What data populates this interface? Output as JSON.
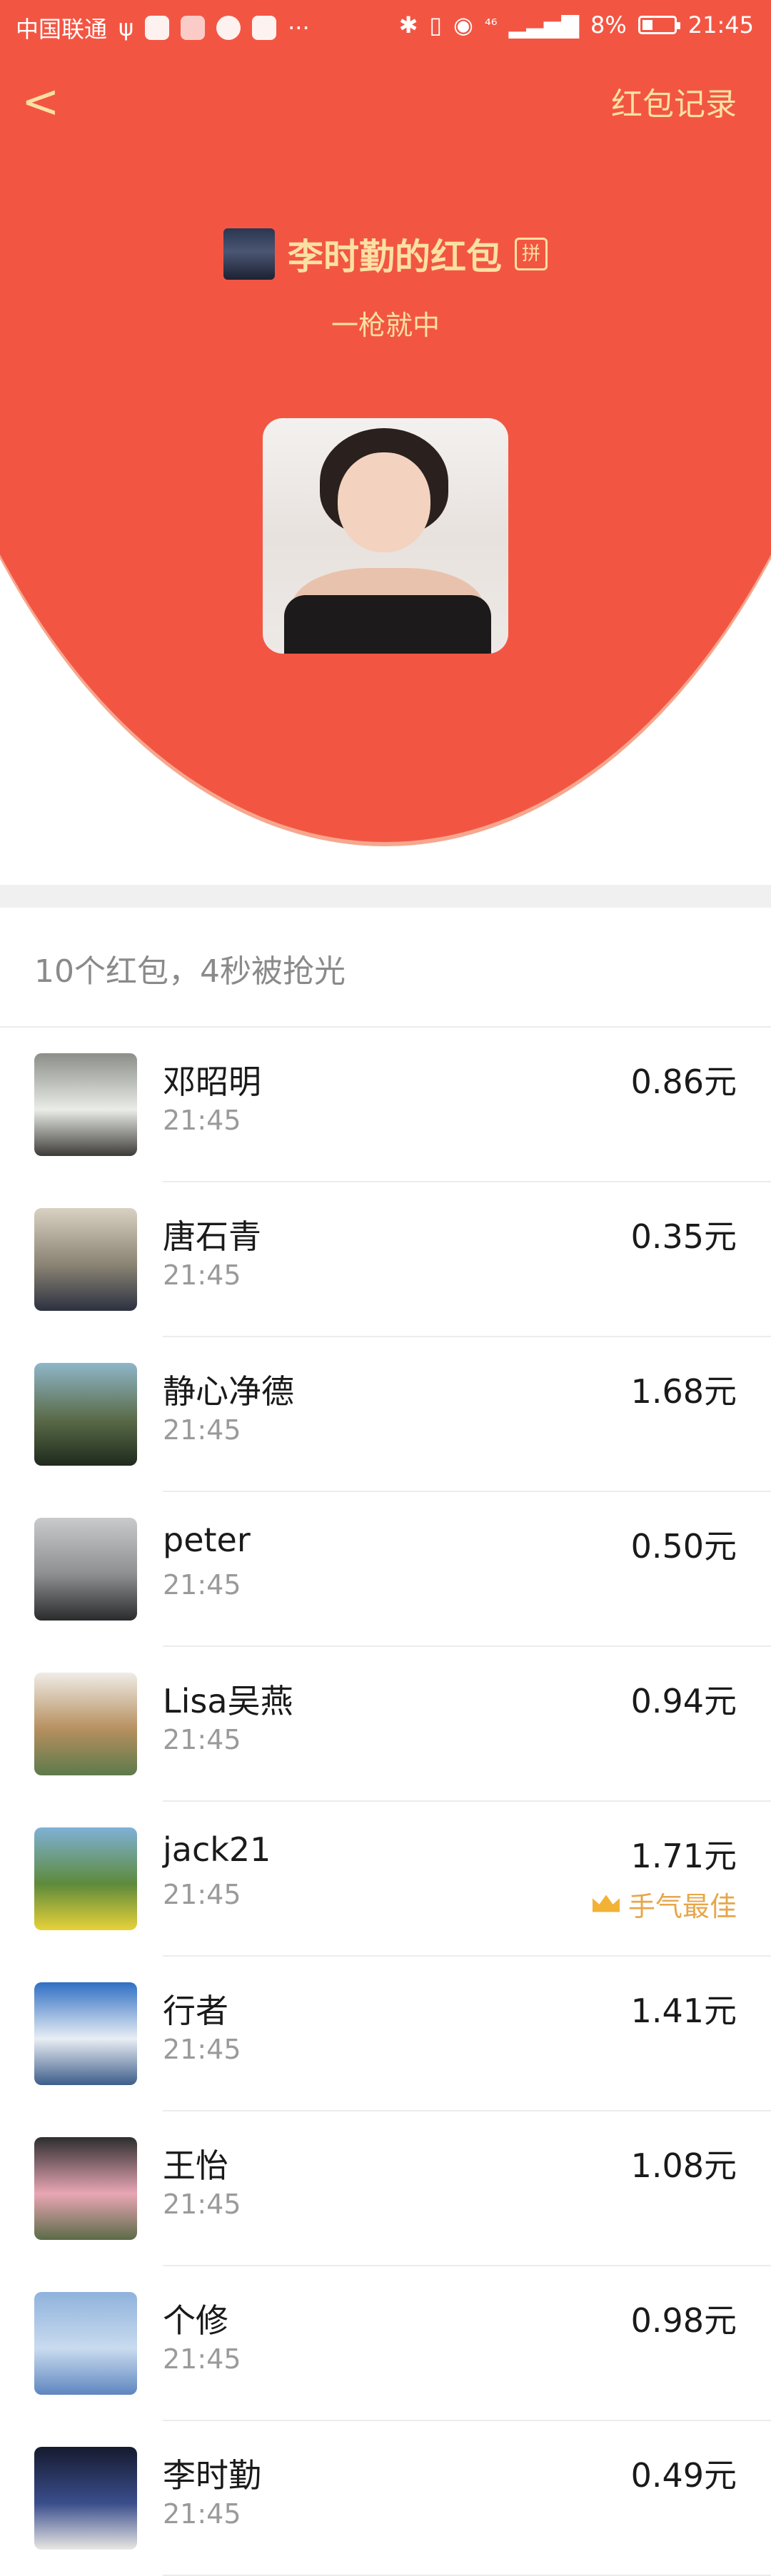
{
  "status_bar": {
    "carrier": "中国联通",
    "usb_glyph": "ψ",
    "more": "···",
    "network": "⁴⁶",
    "battery_pct": "8%",
    "time": "21:45"
  },
  "nav": {
    "back_glyph": "<",
    "records_link": "红包记录"
  },
  "packet": {
    "sender_title": "李时勤的红包",
    "pin_badge": "拼",
    "greeting": "一枪就中"
  },
  "summary": "10个红包，4秒被抢光",
  "best_label": "手气最佳",
  "recipients": [
    {
      "name": "邓昭明",
      "time": "21:45",
      "amount": "0.86元",
      "avatar_colors": [
        "#8b8f88",
        "#e9ece7",
        "#3d3b38"
      ]
    },
    {
      "name": "唐石青",
      "time": "21:45",
      "amount": "0.35元",
      "avatar_colors": [
        "#d9d2c4",
        "#8b8474",
        "#2c3140"
      ]
    },
    {
      "name": "静心净德",
      "time": "21:45",
      "amount": "1.68元",
      "avatar_colors": [
        "#8fb6c9",
        "#5a6b48",
        "#1f2a1d"
      ]
    },
    {
      "name": "peter",
      "time": "21:45",
      "amount": "0.50元",
      "avatar_colors": [
        "#c9cacb",
        "#8d8f90",
        "#2a2b2c"
      ]
    },
    {
      "name": "Lisa吴燕",
      "time": "21:45",
      "amount": "0.94元",
      "avatar_colors": [
        "#efece6",
        "#b68f5f",
        "#5d7a4b"
      ]
    },
    {
      "name": "jack21",
      "time": "21:45",
      "amount": "1.71元",
      "best": true,
      "avatar_colors": [
        "#7fb1d6",
        "#5d8a3b",
        "#e8d23a"
      ]
    },
    {
      "name": "行者",
      "time": "21:45",
      "amount": "1.41元",
      "avatar_colors": [
        "#2f6fc4",
        "#e9eef4",
        "#3d5d8a"
      ]
    },
    {
      "name": "王怡",
      "time": "21:45",
      "amount": "1.08元",
      "avatar_colors": [
        "#2d2e2f",
        "#e9a6b4",
        "#5b6b48"
      ]
    },
    {
      "name": "个修",
      "time": "21:45",
      "amount": "0.98元",
      "avatar_colors": [
        "#8fb2dc",
        "#c9dbef",
        "#5e86bf"
      ]
    },
    {
      "name": "李时勤",
      "time": "21:45",
      "amount": "0.49元",
      "avatar_colors": [
        "#151a2e",
        "#3a4e8c",
        "#e9e7e4"
      ]
    }
  ],
  "colors": {
    "header_red": "#f25643",
    "gold_text": "#fbe0a4",
    "best_gold": "#e7a64a"
  }
}
